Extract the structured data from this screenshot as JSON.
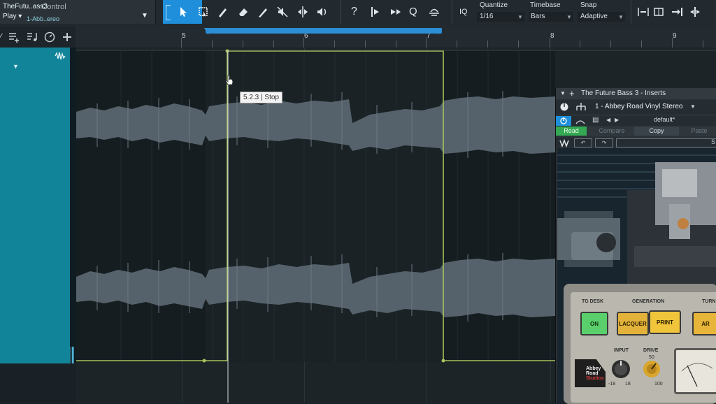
{
  "toolbar": {
    "control_title": "Control",
    "play_mode": "Play",
    "quantize_title": "Quantize",
    "quantize_value": "1/16",
    "timebase_title": "Timebase",
    "timebase_value": "Bars",
    "snap_title": "Snap",
    "snap_value": "Adaptive",
    "iq_label": "IQ",
    "help_label": "?",
    "q_label": "Q"
  },
  "ruler": {
    "bars": [
      "5",
      "6",
      "7",
      "8",
      "9"
    ]
  },
  "track": {
    "name": "TheFutu..ass3",
    "insert": "1-Abb..ereo"
  },
  "tooltip": "5.2.3 | Stop",
  "inserts": {
    "title": "The Future Bass 3 - Inserts",
    "plugin": "1 - Abbey Road Vinyl Stereo",
    "preset": "default*",
    "read": "Read",
    "compare": "Compare",
    "copy": "Copy",
    "paste": "Paste",
    "slot_label": "S"
  },
  "plugin_panel": {
    "tg_desk": "TG DESK",
    "generation": "GENERATION",
    "turn": "TURN",
    "on": "ON",
    "lacquer": "LACQUER",
    "print": "PRINT",
    "ar": "AR",
    "input": "INPUT",
    "drive": "DRIVE",
    "drive_mid": "50",
    "drive_max": "100",
    "input_min": "-18",
    "input_max": "18",
    "logo_line1": "Abbey",
    "logo_line2": "Road",
    "logo_line3": "Studios"
  },
  "colors": {
    "accent": "#1f8fdc",
    "track": "#12849a",
    "envelope": "#a6c35a",
    "waveform": "#59646d"
  }
}
